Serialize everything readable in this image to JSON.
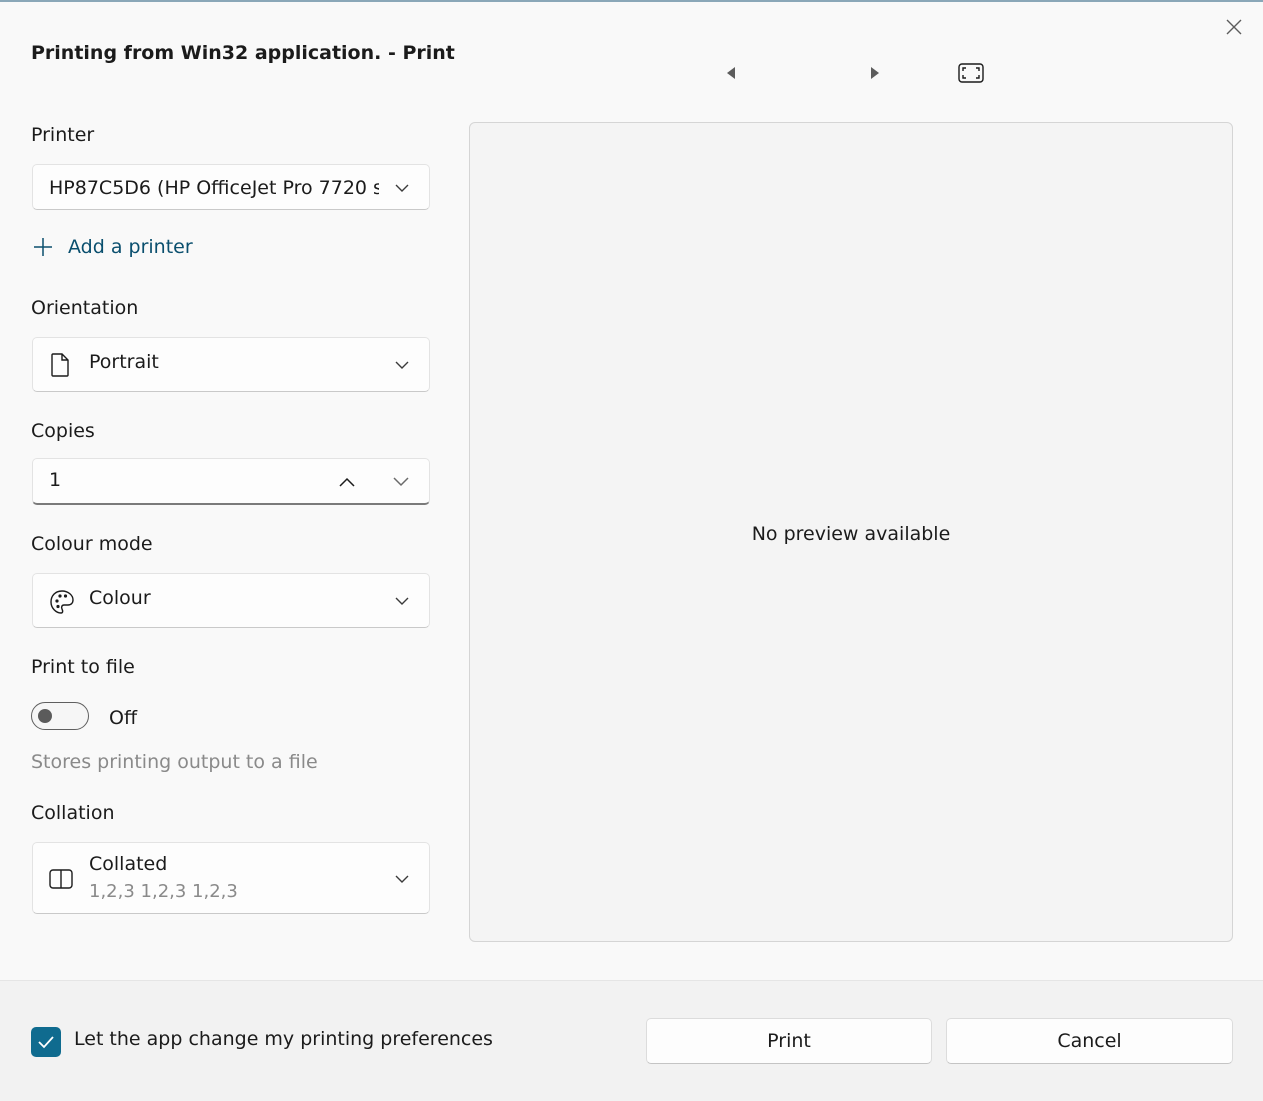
{
  "window": {
    "title": "Printing from Win32 application. - Print",
    "close_icon": "close-icon"
  },
  "preview_nav": {
    "prev_icon": "triangle-left-icon",
    "next_icon": "triangle-right-icon",
    "fit_icon": "fit-page-icon"
  },
  "printer": {
    "label": "Printer",
    "selected": "HP87C5D6 (HP OfficeJet Pro 7720 s",
    "add_label": "Add a printer"
  },
  "orientation": {
    "label": "Orientation",
    "selected": "Portrait",
    "icon": "page-icon"
  },
  "copies": {
    "label": "Copies",
    "value": "1"
  },
  "colour_mode": {
    "label": "Colour mode",
    "selected": "Colour",
    "icon": "palette-icon"
  },
  "print_to_file": {
    "label": "Print to file",
    "state": "Off",
    "description": "Stores printing output to a file"
  },
  "collation": {
    "label": "Collation",
    "selected": "Collated",
    "sub": "1,2,3 1,2,3 1,2,3",
    "icon": "book-open-icon"
  },
  "preview": {
    "message": "No preview available"
  },
  "footer": {
    "preferences_label": "Let the app change my printing preferences",
    "preferences_checked": true,
    "print_label": "Print",
    "cancel_label": "Cancel"
  },
  "colors": {
    "accent": "#0f6b8f",
    "link": "#0a4f6e"
  }
}
